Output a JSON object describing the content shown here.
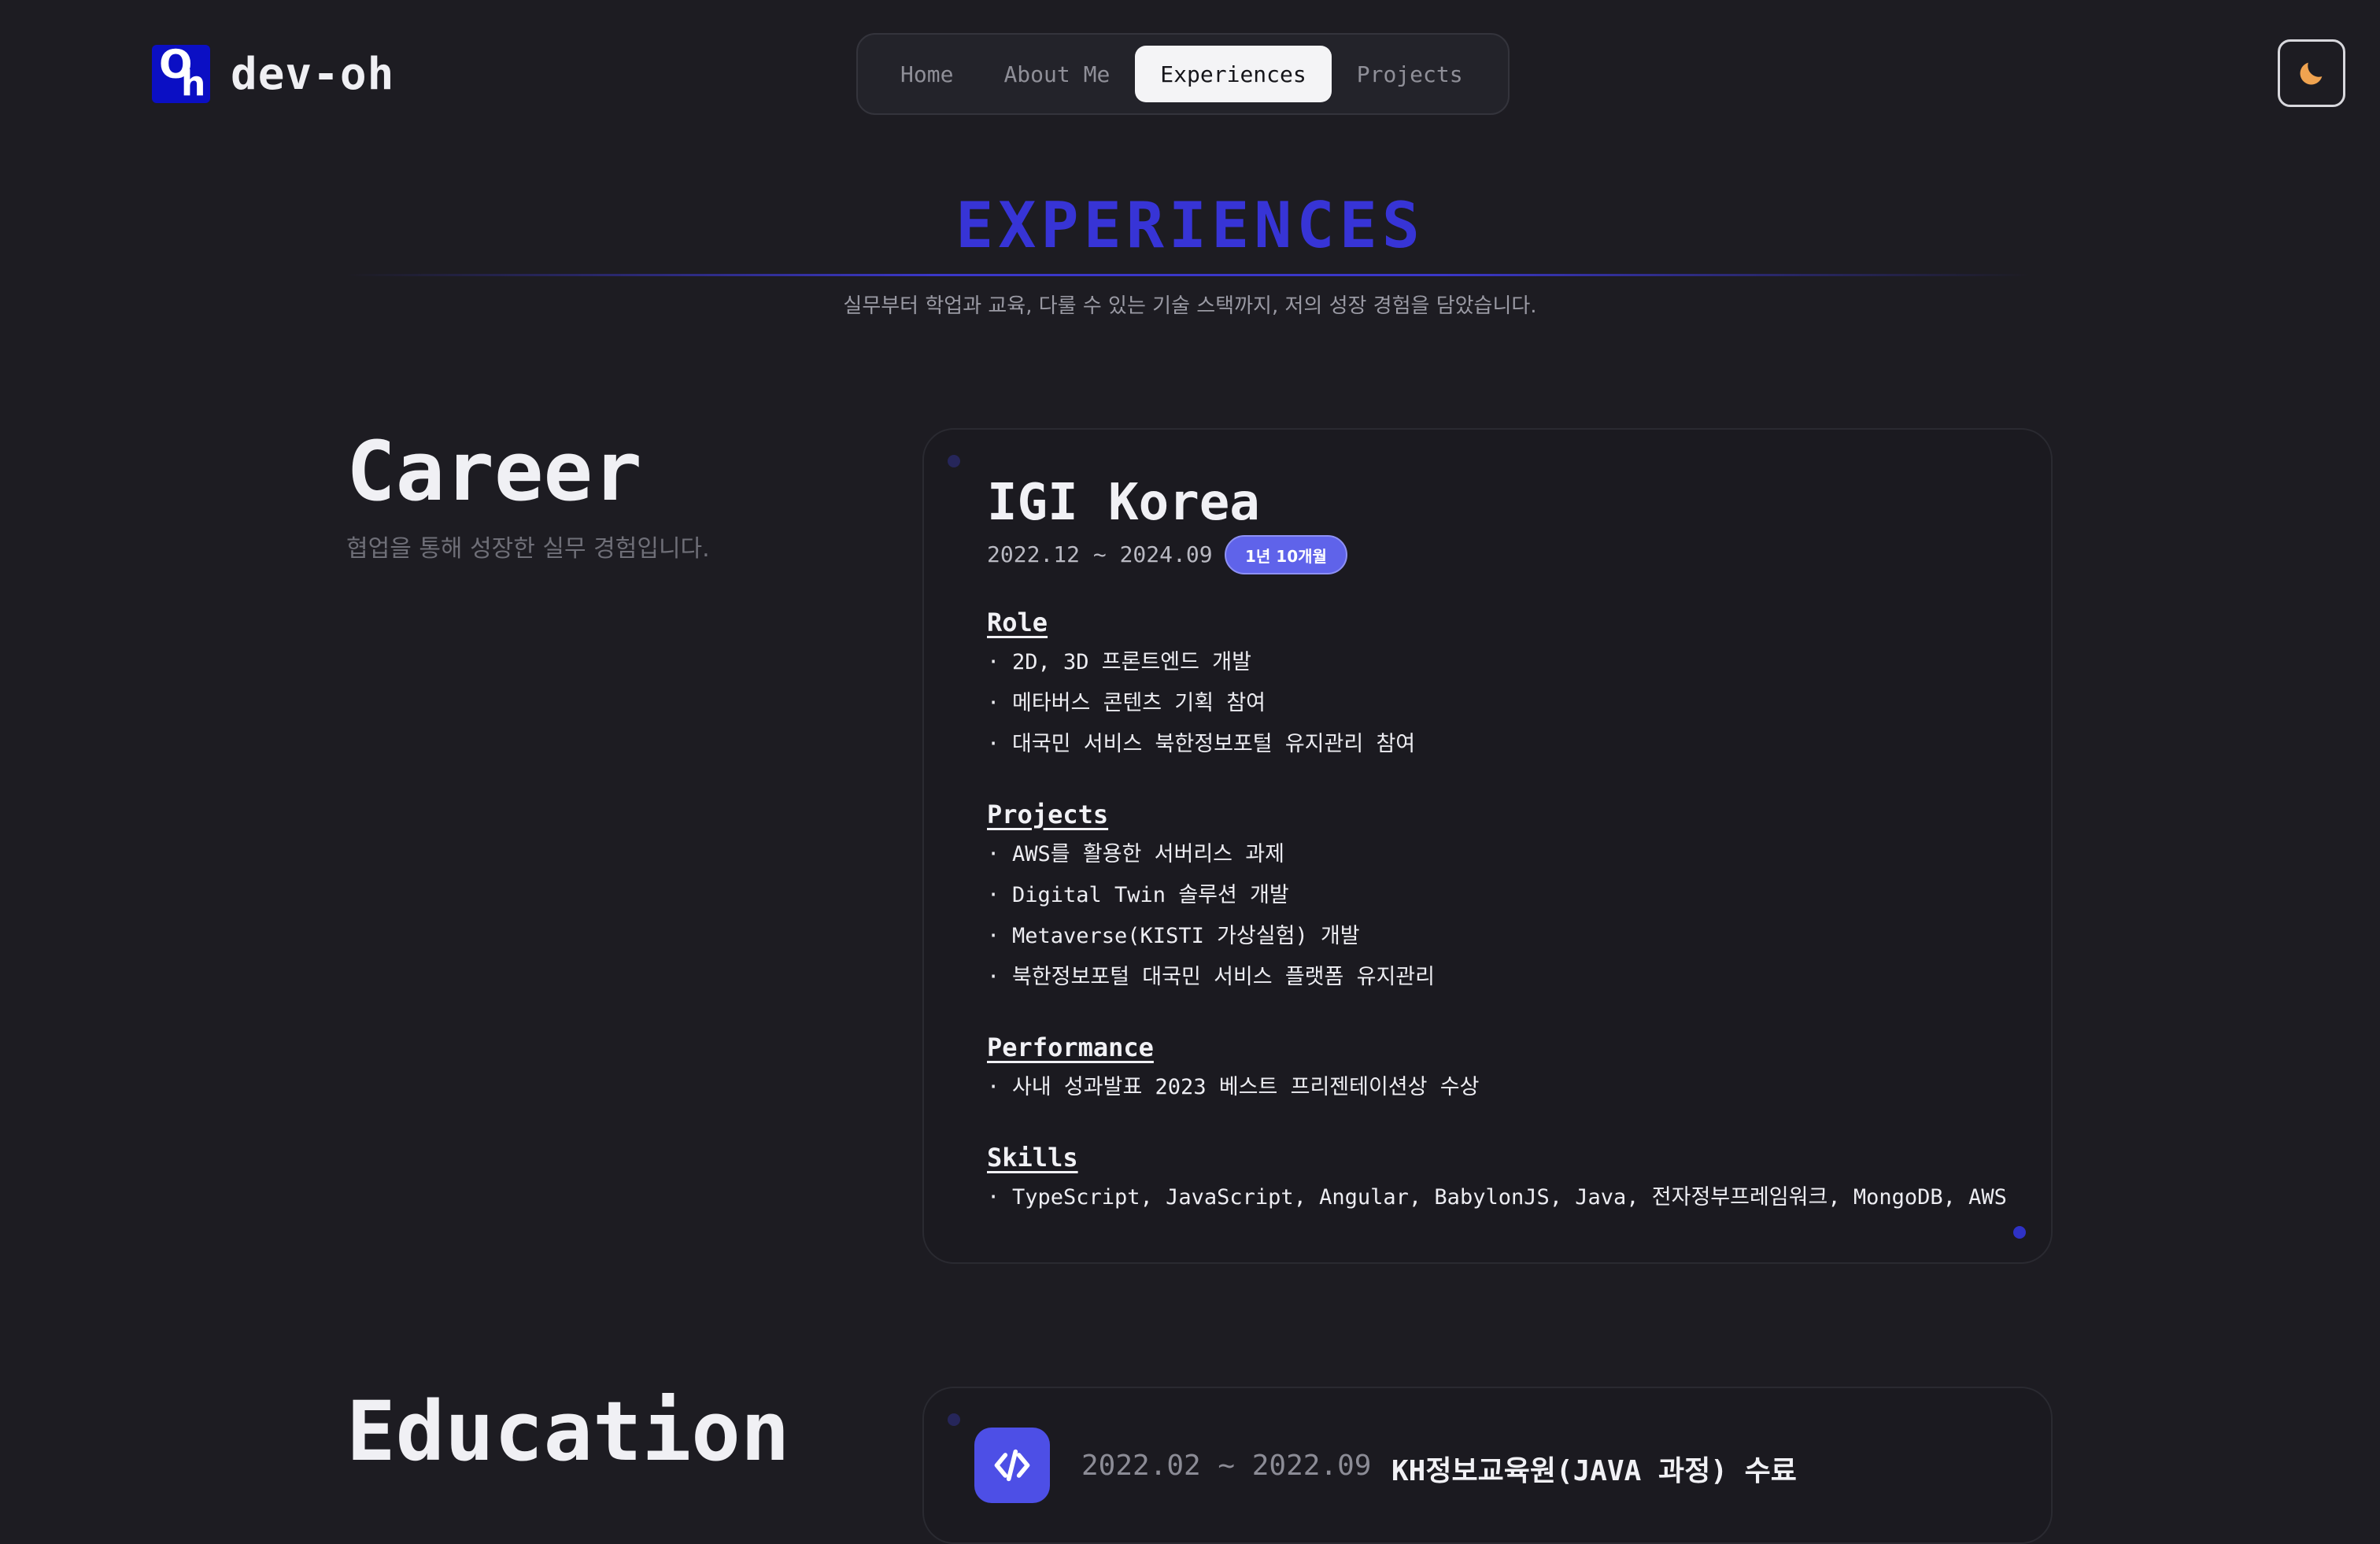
{
  "brand": {
    "logo_o": "O",
    "logo_h": "h",
    "name": "dev-oh"
  },
  "nav": {
    "items": [
      {
        "label": "Home"
      },
      {
        "label": "About Me"
      },
      {
        "label": "Experiences"
      },
      {
        "label": "Projects"
      }
    ],
    "active": "Experiences"
  },
  "theme_toggle": {
    "icon": "moon-icon"
  },
  "page": {
    "title": "EXPERIENCES",
    "subtitle": "실무부터 학업과 교육, 다룰 수 있는 기술 스택까지, 저의 성장 경험을 담았습니다."
  },
  "career": {
    "heading": "Career",
    "description": "협업을 통해 성장한 실무 경험입니다.",
    "company": "IGI Korea",
    "period": "2022.12 ~ 2024.09",
    "duration_badge": "1년 10개월",
    "groups": [
      {
        "title": "Role",
        "items": [
          "2D, 3D 프론트엔드 개발",
          "메타버스 콘텐츠 기획 참여",
          "대국민 서비스 북한정보포털 유지관리 참여"
        ]
      },
      {
        "title": "Projects",
        "items": [
          "AWS를 활용한 서버리스 과제",
          "Digital Twin 솔루션 개발",
          "Metaverse(KISTI 가상실험) 개발",
          "북한정보포털 대국민 서비스 플랫폼 유지관리"
        ]
      },
      {
        "title": "Performance",
        "items": [
          "사내 성과발표 2023 베스트 프리젠테이션상 수상"
        ]
      },
      {
        "title": "Skills",
        "items": [
          "TypeScript, JavaScript, Angular, BabylonJS, Java, 전자정부프레임워크, MongoDB, AWS"
        ]
      }
    ]
  },
  "education": {
    "heading": "Education",
    "icon": "code-icon",
    "period": "2022.02 ~ 2022.09",
    "title": "KH정보교육원(JAVA 과정) 수료"
  },
  "colors": {
    "background": "#1d1c22",
    "accent": "#3734d6",
    "badge": "#5f63ea",
    "moon": "#f0a350"
  }
}
